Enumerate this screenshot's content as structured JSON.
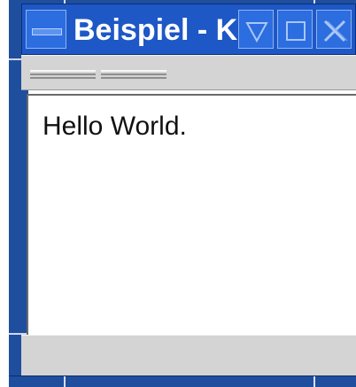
{
  "window": {
    "title": "Beispiel - K",
    "buttons": {
      "menu": "window-menu-icon",
      "minimize": "minimize-triangle-icon",
      "maximize": "maximize-square-icon",
      "close": "close-x-icon"
    }
  },
  "toolbar": {
    "handles": [
      "toolbar-handle",
      "menubar-handle"
    ]
  },
  "content": {
    "text": "Hello World."
  },
  "colors": {
    "titlebar": "#1e58c6",
    "frame": "#1f4e9e",
    "panel": "#d4d4d4",
    "content_bg": "#ffffff"
  }
}
